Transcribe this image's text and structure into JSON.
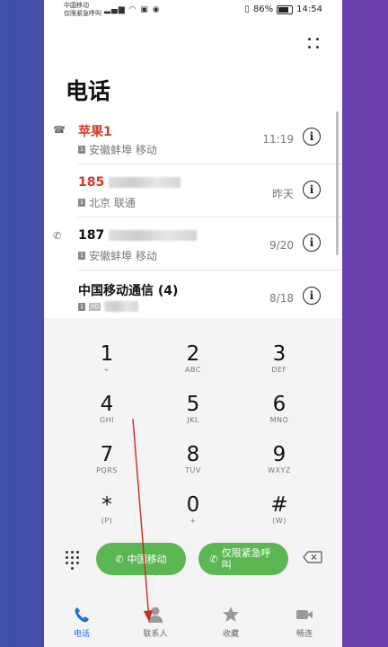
{
  "status_bar": {
    "carrier_line1": "中国移动",
    "carrier_line2": "仅限紧急呼叫",
    "battery": "86%",
    "time": "14:54"
  },
  "header": {
    "title": "电话"
  },
  "calls": [
    {
      "name": "苹果1",
      "missed": true,
      "location": "安徽蚌埠 移动",
      "time": "11:19",
      "direction_icon": "missed-call-icon"
    },
    {
      "name": "185",
      "missed": true,
      "location": "北京 联通",
      "time": "昨天",
      "direction_icon": ""
    },
    {
      "name": "187",
      "missed": false,
      "location": "安徽蚌埠 移动",
      "time": "9/20",
      "direction_icon": "outgoing-call-icon"
    },
    {
      "name": "中国移动通信 (4)",
      "missed": false,
      "location": "",
      "time": "8/18",
      "direction_icon": ""
    }
  ],
  "keypad": [
    {
      "digit": "1",
      "letters": "⌁"
    },
    {
      "digit": "2",
      "letters": "ABC"
    },
    {
      "digit": "3",
      "letters": "DEF"
    },
    {
      "digit": "4",
      "letters": "GHI"
    },
    {
      "digit": "5",
      "letters": "JKL"
    },
    {
      "digit": "6",
      "letters": "MNO"
    },
    {
      "digit": "7",
      "letters": "PQRS"
    },
    {
      "digit": "8",
      "letters": "TUV"
    },
    {
      "digit": "9",
      "letters": "WXYZ"
    },
    {
      "digit": "*",
      "letters": "(P)"
    },
    {
      "digit": "0",
      "letters": "+"
    },
    {
      "digit": "#",
      "letters": "(W)"
    }
  ],
  "actions": {
    "call_sim1": "中国移动",
    "call_emergency": "仅限紧急呼叫"
  },
  "tabs": [
    {
      "label": "电话",
      "active": true
    },
    {
      "label": "联系人",
      "active": false
    },
    {
      "label": "收藏",
      "active": false
    },
    {
      "label": "畅连",
      "active": false
    }
  ],
  "colors": {
    "accent": "#1e6fd9",
    "missed": "#d33a2c",
    "call_green": "#5bb752"
  }
}
